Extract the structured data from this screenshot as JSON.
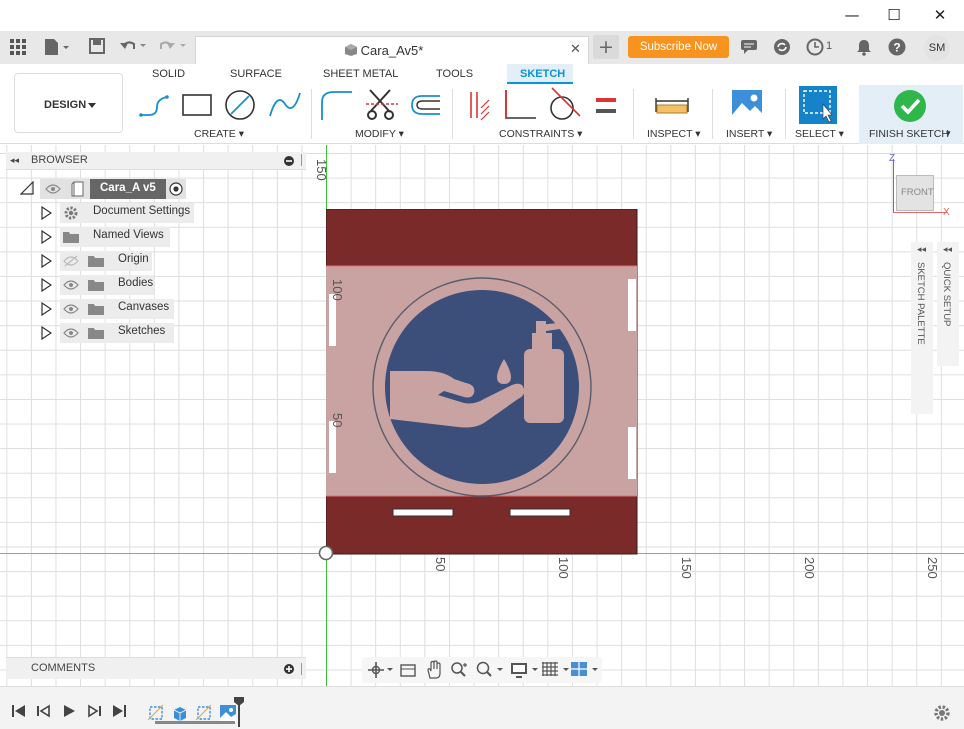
{
  "window": {
    "minimize": "—",
    "maximize": "☐",
    "close": "✕"
  },
  "tabbar": {
    "doc_title": "Cara_Av5*",
    "subscribe_label": "Subscribe Now",
    "jobs_count": "1",
    "user_initials": "SM"
  },
  "ribbon": {
    "workspace": "DESIGN",
    "tabs": [
      "SOLID",
      "SURFACE",
      "SHEET METAL",
      "TOOLS",
      "SKETCH"
    ],
    "active_tab": "SKETCH",
    "groups": [
      "CREATE",
      "MODIFY",
      "CONSTRAINTS",
      "INSPECT",
      "INSERT",
      "SELECT",
      "FINISH SKETCH"
    ]
  },
  "browser": {
    "title": "BROWSER",
    "root": "Cara_A v5",
    "items": [
      "Document Settings",
      "Named Views",
      "Origin",
      "Bodies",
      "Canvases",
      "Sketches"
    ]
  },
  "comments": {
    "title": "COMMENTS"
  },
  "viewcube": {
    "face": "FRONT",
    "axis_z": "Z",
    "axis_x": "X"
  },
  "side_panels": {
    "sketch_palette": "SKETCH PALETTE",
    "quick_setup": "QUICK SETUP"
  },
  "axis_labels": {
    "v150": "150",
    "v100": "100",
    "v50": "50",
    "h50": "50",
    "h100": "100",
    "h150": "150",
    "h200": "200",
    "h250": "250"
  },
  "colors": {
    "accent": "#0696d7",
    "subscribe": "#f7931e",
    "panel_red": "#7b2a2a",
    "image_red": "#c9a3a2",
    "circle_blue": "#3c4e7a",
    "finish_green": "#2fb74c"
  }
}
